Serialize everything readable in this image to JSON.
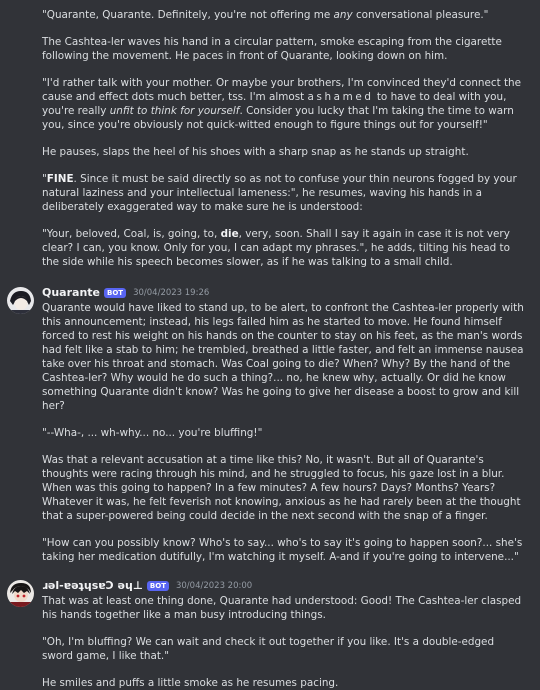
{
  "continuation": {
    "p1_open": "\"Quarante, Quarante. Definitely, you're not offering me ",
    "p1_em": "any",
    "p1_close": " conversational pleasure.\"",
    "p2": "The Cashtea-ler waves his hand in a circular pattern, smoke escaping from the cigarette following the movement. He paces in front of Quarante, looking down on him.",
    "p3_a": "\"I'd rather talk with your mother. Or maybe your brothers, I'm convinced they'd connect the cause and effect dots much better, tss. I'm almost ",
    "p3_spaced": "ashamed",
    "p3_b": " to have to deal with you, you're really ",
    "p3_em": "unfit to think for yourself",
    "p3_c": ". Consider you lucky that I'm taking the time to warn you, since you're obviously not quick-witted enough to figure things out for yourself!\"",
    "p4": "He pauses, slaps the heel of his shoes with a sharp snap as he stands up straight.",
    "p5_open": "\"",
    "p5_bold": "FINE",
    "p5_rest": ". Since it must be said directly so as not to confuse your thin neurons fogged by your natural laziness and your intellectual lameness:\", he resumes, waving his hands in a deliberately exaggerated way to make sure he is understood:",
    "p6_a": "\"Your, beloved, Coal, is, going, to, ",
    "p6_bold": "die",
    "p6_b": ", very, soon. Shall I say it again in case it is not very clear? I can, you know. Only for you, I can adapt my phrases.\", he adds, tilting his head to the side while his speech becomes slower, as if he was talking to a small child."
  },
  "message1": {
    "username": "Quarante",
    "badge": "BOT",
    "timestamp": "30/04/2023 19:26",
    "paragraphs": [
      "Quarante would have liked to stand up, to be alert, to confront the Cashtea-ler properly with this announcement; instead, his legs failed him as he started to move. He found himself forced to rest his weight on his hands on the counter to stay on his feet, as the man's words had felt like a stab to him; he trembled, breathed a little faster, and felt an immense nausea take over his throat and stomach. Was Coal going to die? When? Why? By the hand of the Cashtea-ler? Why would he do such a thing?... no, he knew why, actually. Or did he know something Quarante didn't know? Was he going to give her disease a boost to grow and kill her?",
      "\"--Wha-, ... wh-why... no... you're bluffing!\"",
      "Was that a relevant accusation at a time like this? No, it wasn't. But all of Quarante's thoughts were racing through his mind, and he struggled to focus, his gaze lost in a blur. When was this going to happen? In a few minutes? A few hours? Days? Months? Years? Whatever it was, he felt feverish not knowing, anxious as he had rarely been at the thought that a super-powered being could decide in the next second with the snap of a finger.",
      "\"How can you possibly know? Who's to say... who's to say it's going to happen soon?... she's taking her medication dutifully, I'm watching it myself. A-and if you're going to intervene...\""
    ]
  },
  "message2": {
    "username": "ɹǝl-ɐǝʇɥsɐƆ ǝɥ⊥",
    "badge": "BOT",
    "timestamp": "30/04/2023 20:00",
    "paragraphs": [
      "That was at least one thing done, Quarante had understood: Good! The Cashtea-ler clasped his hands together like a man busy introducing things.",
      "\"Oh, I'm bluffing? We can wait and check it out together if you like. It's a double-edged sword game, I like that.\"",
      "He smiles and puffs a little smoke as he resumes pacing."
    ]
  }
}
